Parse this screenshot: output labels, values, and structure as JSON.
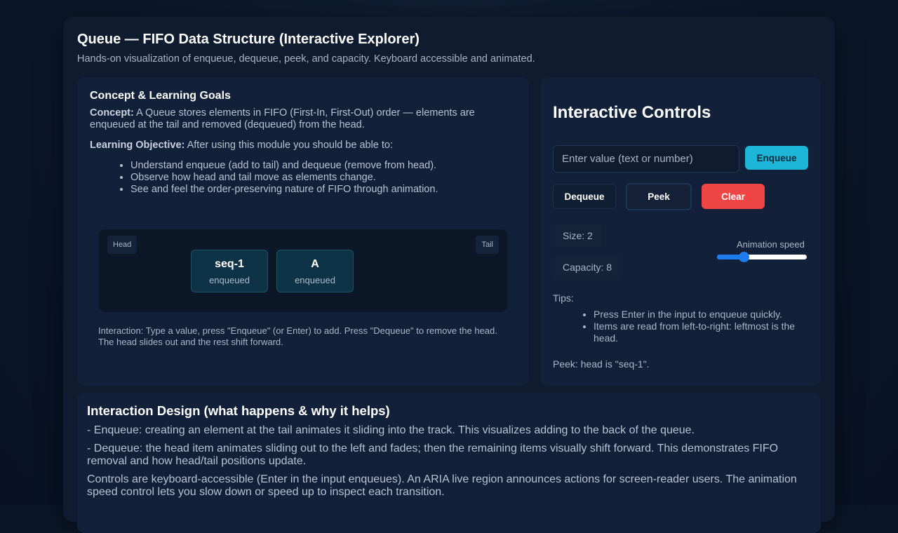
{
  "header": {
    "title": "Queue — FIFO Data Structure (Interactive Explorer)",
    "subtitle": "Hands-on visualization of enqueue, dequeue, peek, and capacity. Keyboard accessible and animated."
  },
  "concept": {
    "title": "Concept & Learning Goals",
    "concept_label": "Concept:",
    "concept_text": " A Queue stores elements in FIFO (First-In, First-Out) order — elements are enqueued at the tail and removed (dequeued) from the head.",
    "objective_label": "Learning Objective:",
    "objective_text": " After using this module you should be able to:",
    "goals": [
      "Understand enqueue (add to tail) and dequeue (remove from head).",
      "Observe how head and tail move as elements change.",
      "See and feel the order-preserving nature of FIFO through animation."
    ]
  },
  "queue": {
    "head_label": "Head",
    "tail_label": "Tail",
    "items": [
      {
        "value": "seq-1",
        "status": "enqueued"
      },
      {
        "value": "A",
        "status": "enqueued"
      }
    ],
    "interaction_note": "Interaction: Type a value, press \"Enqueue\" (or Enter) to add. Press \"Dequeue\" to remove the head. The head slides out and the rest shift forward."
  },
  "controls": {
    "title": "Interactive Controls",
    "input_placeholder": "Enter value (text or number)",
    "input_value": "",
    "enqueue_label": "Enqueue",
    "dequeue_label": "Dequeue",
    "peek_label": "Peek",
    "clear_label": "Clear",
    "size_text": "Size: 2",
    "capacity_text": "Capacity: 8",
    "speed_label": "Animation speed",
    "speed_level": 0.3,
    "tips_title": "Tips:",
    "tips": [
      "Press Enter in the input to enqueue quickly.",
      "Items are read from left-to-right: leftmost is the head."
    ],
    "peek_status": "Peek: head is \"seq-1\"."
  },
  "design": {
    "title": "Interaction Design (what happens & why it helps)",
    "paragraphs": [
      "- Enqueue: creating an element at the tail animates it sliding into the track. This visualizes adding to the back of the queue.",
      "- Dequeue: the head item animates sliding out to the left and fades; then the remaining items visually shift forward. This demonstrates FIFO removal and how head/tail positions update.",
      "Controls are keyboard-accessible (Enter in the input enqueues). An ARIA live region announces actions for screen-reader users. The animation speed control lets you slow down or speed up to inspect each transition."
    ]
  },
  "colors": {
    "accent": "#1eb6d8",
    "danger": "#ef4545",
    "slider": "#1e7cf0"
  }
}
